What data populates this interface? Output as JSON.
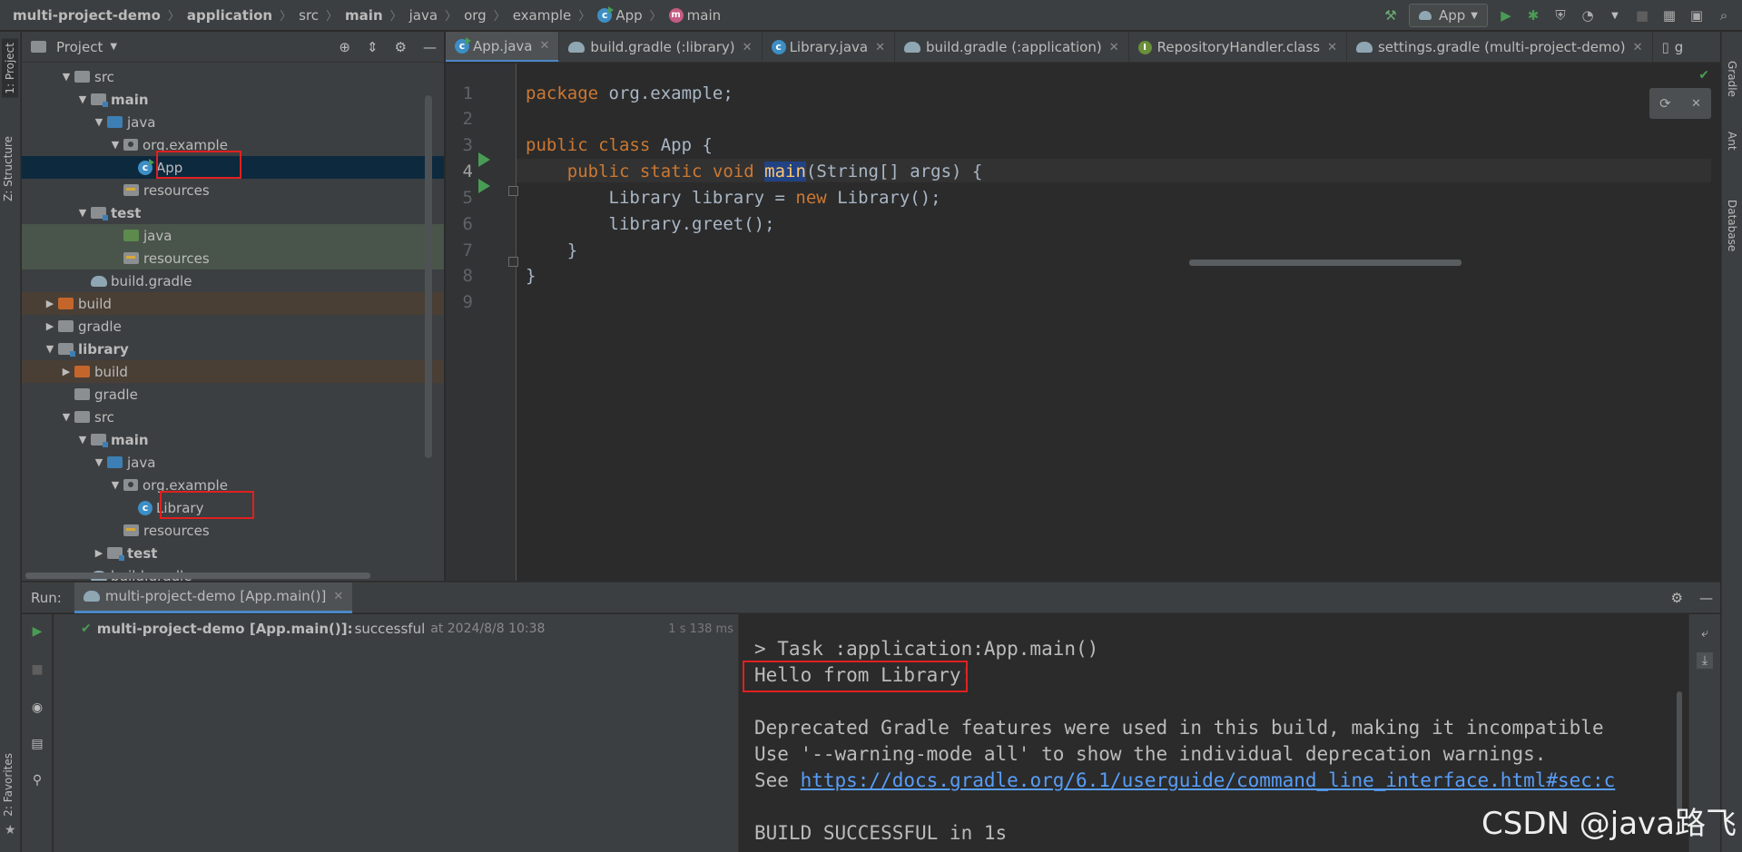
{
  "breadcrumbs": [
    "multi-project-demo",
    "application",
    "src",
    "main",
    "java",
    "org",
    "example",
    "App",
    "main"
  ],
  "run_config": {
    "label": "App"
  },
  "left_stripe": {
    "project_tab": "1: Project",
    "structure_tab": "Z: Structure",
    "favorites_tab": "2: Favorites"
  },
  "right_stripe": {
    "gradle": "Gradle",
    "ant": "Ant",
    "database": "Database"
  },
  "project_panel": {
    "title": "Project",
    "rows": [
      {
        "label": "src"
      },
      {
        "label": "main"
      },
      {
        "label": "java"
      },
      {
        "label": "org.example"
      },
      {
        "label": "App"
      },
      {
        "label": "resources"
      },
      {
        "label": "test"
      },
      {
        "label": "java"
      },
      {
        "label": "resources"
      },
      {
        "label": "build.gradle"
      },
      {
        "label": "build"
      },
      {
        "label": "gradle"
      },
      {
        "label": "library"
      },
      {
        "label": "build"
      },
      {
        "label": "gradle"
      },
      {
        "label": "src"
      },
      {
        "label": "main"
      },
      {
        "label": "java"
      },
      {
        "label": "org.example"
      },
      {
        "label": "Library"
      },
      {
        "label": "resources"
      },
      {
        "label": "test"
      },
      {
        "label": "build.gradle"
      }
    ]
  },
  "editor": {
    "tabs": [
      {
        "label": "App.java"
      },
      {
        "label": "build.gradle (:library)"
      },
      {
        "label": "Library.java"
      },
      {
        "label": "build.gradle (:application)"
      },
      {
        "label": "RepositoryHandler.class"
      },
      {
        "label": "settings.gradle (multi-project-demo)"
      },
      {
        "label": "g"
      }
    ],
    "line_numbers": [
      "1",
      "2",
      "3",
      "4",
      "5",
      "6",
      "7",
      "8",
      "9"
    ],
    "code": {
      "l1_kw": "package",
      "l1_rest": " org.example;",
      "l3_kw": "public class",
      "l3_rest": " App {",
      "l4_kw": "public static void",
      "l4_fn": "main",
      "l4_rest": "(String[] args) {",
      "l5_a": "Library library = ",
      "l5_kw": "new",
      "l5_b": " Library();",
      "l6": "library.greet();",
      "l7": "}",
      "l8": "}"
    }
  },
  "run_panel": {
    "label": "Run:",
    "tab": "multi-project-demo [App.main()]",
    "result_name": "multi-project-demo [App.main()]:",
    "result_status": "successful",
    "result_at": "at 2024/8/8 10:38",
    "result_time": "1 s 138 ms",
    "console": {
      "line1": "> Task :application:App.main()",
      "line2": "Hello from Library!",
      "line3": "Deprecated Gradle features were used in this build, making it incompatible",
      "line4": "Use '--warning-mode all' to show the individual deprecation warnings.",
      "line5_prefix": "See ",
      "line5_link": "https://docs.gradle.org/6.1/userguide/command_line_interface.html#sec:c",
      "line6": "BUILD SUCCESSFUL in 1s"
    }
  },
  "watermark": "CSDN @java路飞",
  "colors": {
    "accent": "#4a88c7",
    "keyword": "#cc7832",
    "success": "#499c54",
    "highlight": "#e02020"
  }
}
